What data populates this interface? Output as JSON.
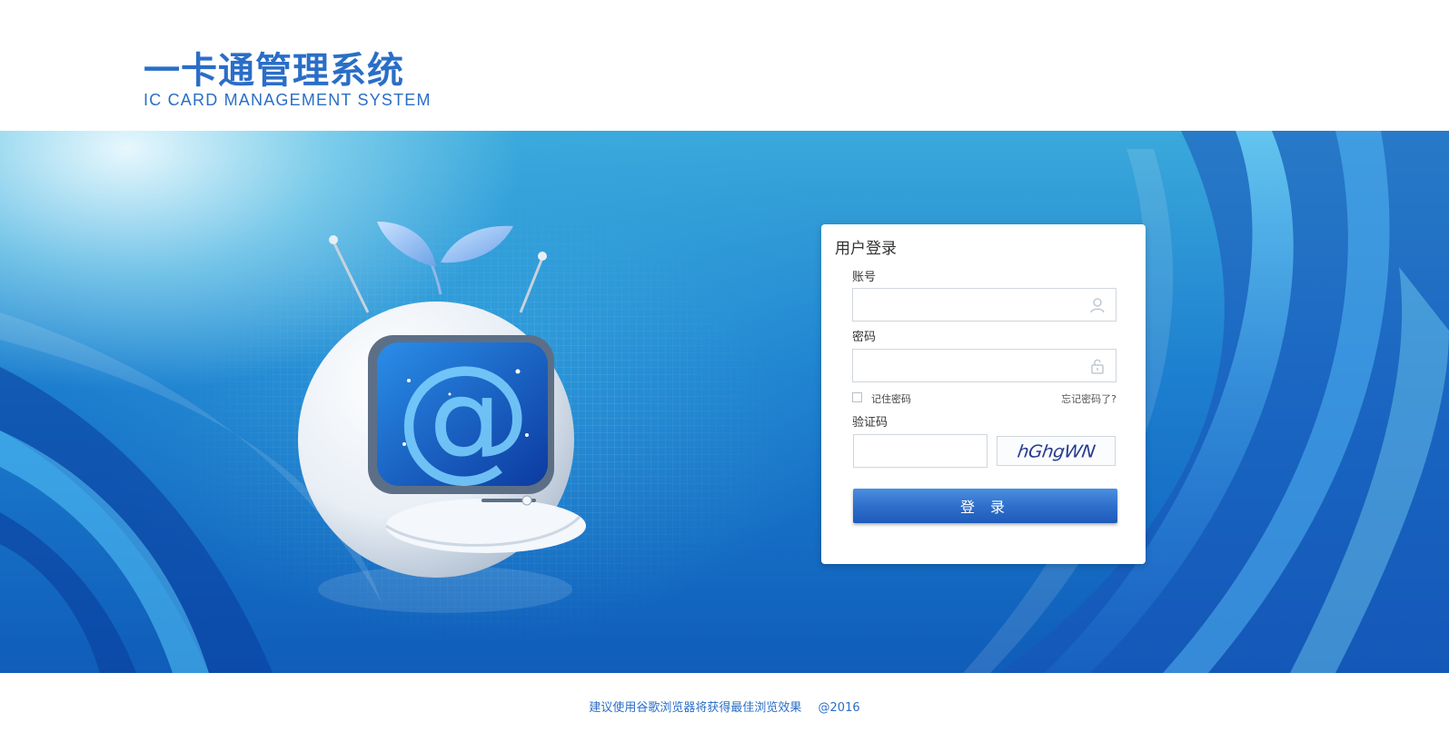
{
  "header": {
    "title": "一卡通管理系统",
    "subtitle": "IC CARD MANAGEMENT SYSTEM"
  },
  "login": {
    "title": "用户登录",
    "account_label": "账号",
    "account_value": "",
    "password_label": "密码",
    "password_value": "",
    "remember_label": "记住密码",
    "remember_checked": false,
    "forgot_label": "忘记密码了?",
    "captcha_label": "验证码",
    "captcha_value": "",
    "captcha_image_text": "hGhgWN",
    "submit_label": "登 录"
  },
  "footer": {
    "tip": "建议使用谷歌浏览器将获得最佳浏览效果",
    "copyright": "@2016"
  },
  "icons": {
    "account": "user-icon",
    "password": "lock-icon"
  },
  "colors": {
    "brand": "#2a6ec7",
    "button": "#2f6fcc",
    "banner": "#1d7fcf"
  }
}
